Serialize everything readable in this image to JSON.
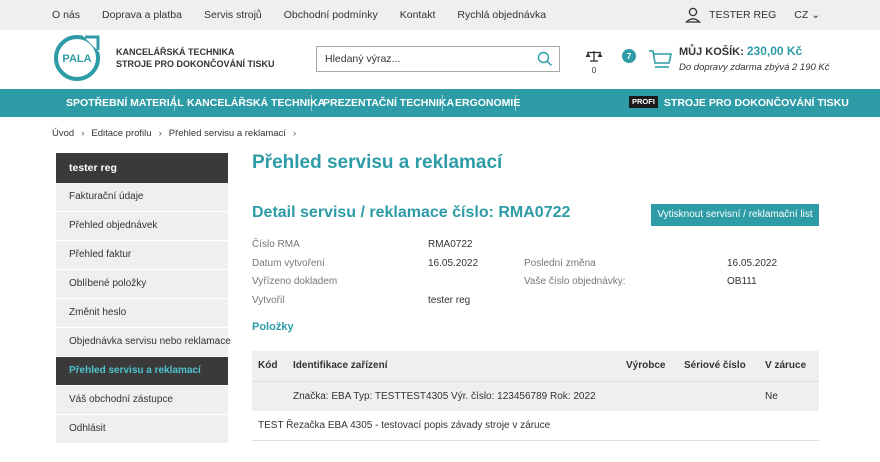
{
  "topbar": {
    "links": [
      "O nás",
      "Doprava a platba",
      "Servis strojů",
      "Obchodní podmínky",
      "Kontakt",
      "Rychlá objednávka"
    ],
    "user": "TESTER REG",
    "lang": "CZ"
  },
  "header": {
    "logo_text": "PALA",
    "tagline_1": "KANCELÁŘSKÁ TECHNIKA",
    "tagline_2": "STROJE PRO DOKONČOVÁNÍ TISKU",
    "search_placeholder": "Hledaný výraz...",
    "compare_count": "0",
    "favorites_count": "7",
    "cart_label": "MŮJ KOŠÍK:",
    "cart_total": "230,00 Kč",
    "cart_shipping": "Do dopravy zdarma zbývá 2 190 Kč"
  },
  "nav": {
    "items": [
      "SPOTŘEBNÍ MATERIÁL",
      "KANCELÁŘSKÁ TECHNIKA",
      "PREZENTAČNÍ TECHNIKA",
      "ERGONOMIE"
    ],
    "profi_badge": "PROFI",
    "profi_item": "STROJE PRO DOKONČOVÁNÍ TISKU"
  },
  "breadcrumb": [
    "Úvod",
    "Editace profilu",
    "Přehled servisu a reklamací"
  ],
  "sidebar": {
    "heading": "tester reg",
    "items": [
      "Fakturační údaje",
      "Přehled objednávek",
      "Přehled faktur",
      "Oblíbené položky",
      "Změnit heslo",
      "Objednávka servisu nebo reklamace",
      "Přehled servisu a reklamací",
      "Váš obchodní zástupce",
      "Odhlásit"
    ]
  },
  "main": {
    "title": "Přehled servisu a reklamací",
    "detail_title": "Detail servisu / reklamace číslo: RMA0722",
    "print_button": "Vytisknout servisní / reklamační list",
    "fields": {
      "rma_label": "Číslo RMA",
      "rma_value": "RMA0722",
      "created_label": "Datum vytvoření",
      "created_value": "16.05.2022",
      "changed_label": "Poslední změna",
      "changed_value": "16.05.2022",
      "settled_label": "Vyřízeno dokladem",
      "order_label": "Vaše číslo objednávky:",
      "order_value": "OB111",
      "author_label": "Vytvořil",
      "author_value": "tester reg"
    },
    "items_title": "Položky",
    "table": {
      "headers": [
        "Kód",
        "Identifikace zařízení",
        "Výrobce",
        "Sériové číslo",
        "V záruce"
      ],
      "rows": [
        {
          "code": "",
          "device": "Značka: EBA Typ: TESTTEST4305 Výr. číslo: 123456789 Rok: 2022",
          "maker": "",
          "serial": "",
          "warranty": "Ne"
        }
      ],
      "note": "TEST Řezačka EBA 4305 - testovací popis závady stroje v záruce"
    }
  },
  "colors": {
    "accent": "#2d9ca6",
    "dark": "#3a3a3a",
    "light": "#efefef"
  }
}
